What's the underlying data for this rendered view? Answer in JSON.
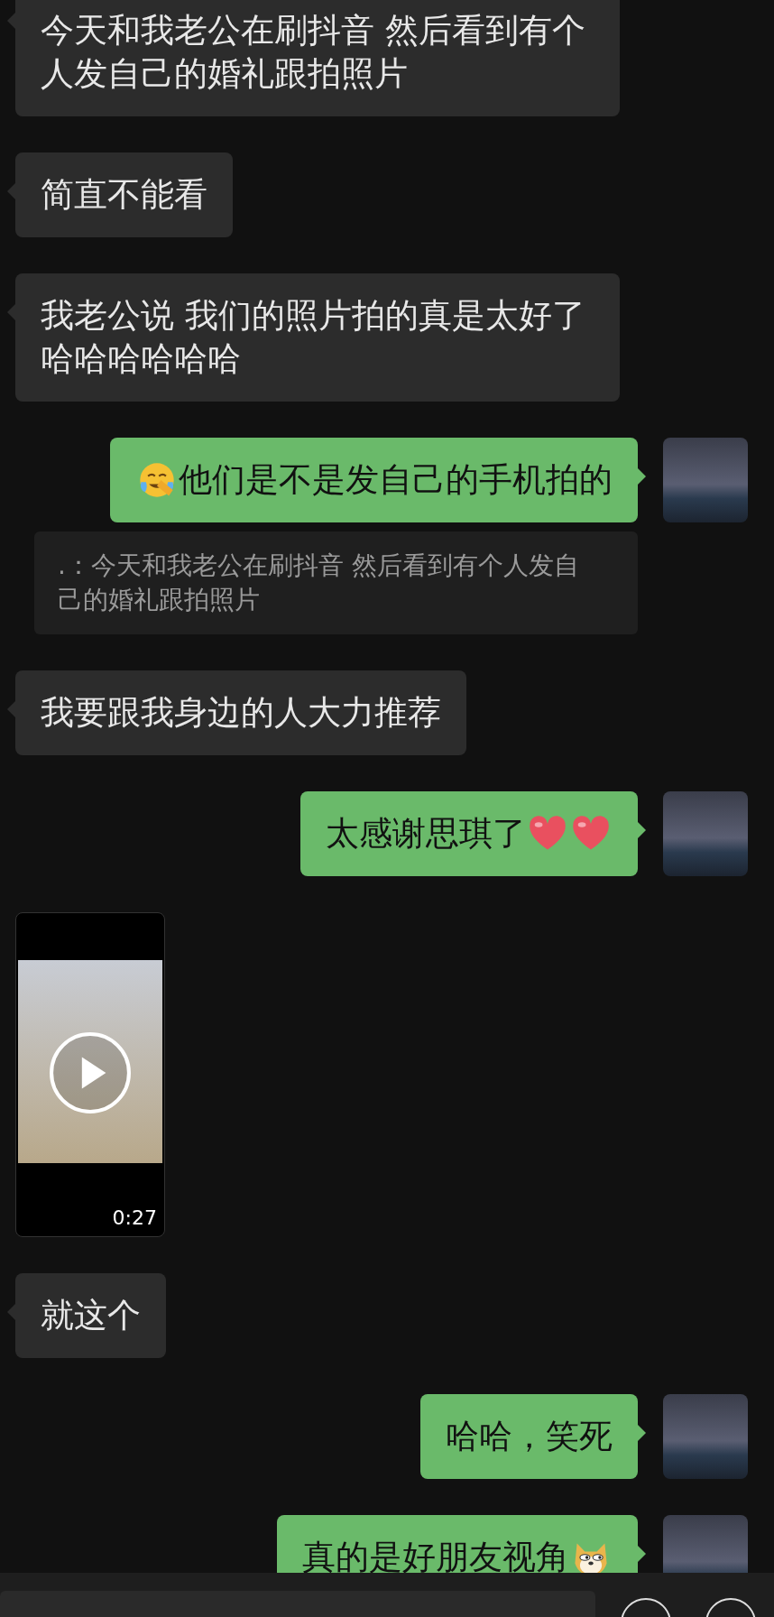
{
  "messages": [
    {
      "kind": "text",
      "sent": false,
      "text": "今天和我老公在刷抖音 然后看到有个人发自己的婚礼跟拍照片"
    },
    {
      "kind": "text",
      "sent": false,
      "text": "简直不能看"
    },
    {
      "kind": "text",
      "sent": false,
      "text": "我老公说 我们的照片拍的真是太好了哈哈哈哈哈哈"
    },
    {
      "kind": "text",
      "sent": true,
      "text": "他们是不是发自己的手机拍的",
      "emojis": [
        {
          "kind": "facepalm"
        }
      ],
      "emoji_first": true
    },
    {
      "kind": "quote",
      "text": ".：今天和我老公在刷抖音 然后看到有个人发自己的婚礼跟拍照片"
    },
    {
      "kind": "text",
      "sent": false,
      "text": "我要跟我身边的人大力推荐"
    },
    {
      "kind": "text",
      "sent": true,
      "text": "太感谢思琪了",
      "emojis": [
        {
          "kind": "heart"
        },
        {
          "kind": "heart"
        }
      ],
      "emoji_first": false
    },
    {
      "kind": "video",
      "sent": false,
      "duration": "0:27"
    },
    {
      "kind": "text",
      "sent": false,
      "text": "就这个"
    },
    {
      "kind": "text",
      "sent": true,
      "text": "哈哈，笑死"
    },
    {
      "kind": "text",
      "sent": true,
      "text": "真的是好朋友视角",
      "emojis": [
        {
          "kind": "doge"
        }
      ],
      "emoji_first": false
    }
  ]
}
